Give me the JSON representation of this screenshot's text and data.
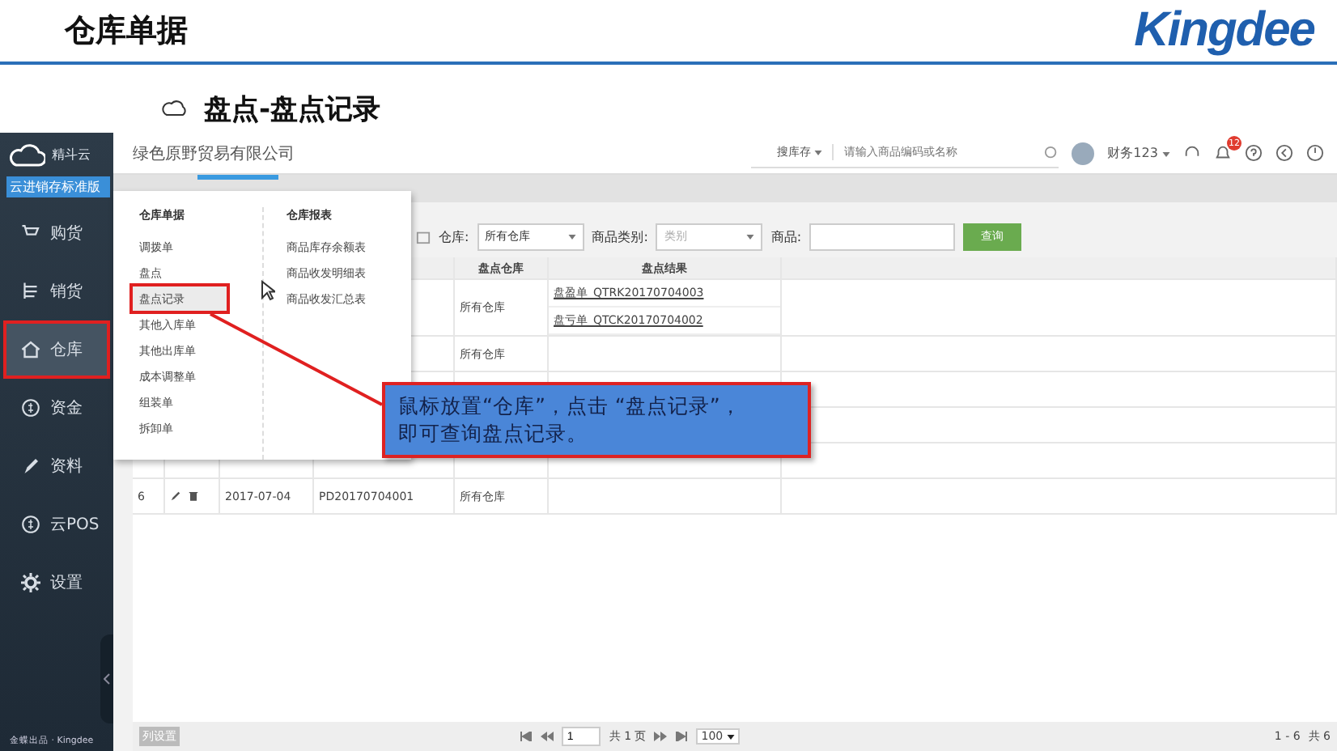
{
  "slide": {
    "title": "仓库单据",
    "logo": "Kingdee",
    "subtitle": "盘点-盘点记录"
  },
  "app": {
    "brand": "精斗云",
    "edition": "云进销存标准版",
    "company": "绿色原野贸易有限公司",
    "search": {
      "scope": "搜库存",
      "placeholder": "请输入商品编码或名称"
    },
    "user": "财务123",
    "notifications": "12",
    "sidebar": [
      {
        "label": "购货",
        "selected": false
      },
      {
        "label": "销货",
        "selected": false
      },
      {
        "label": "仓库",
        "selected": true
      },
      {
        "label": "资金",
        "selected": false
      },
      {
        "label": "资料",
        "selected": false
      },
      {
        "label": "云POS",
        "selected": false
      },
      {
        "label": "设置",
        "selected": false
      }
    ],
    "footer": "金蝶出品 · Kingdee",
    "filters": [
      {
        "label": "仓库:",
        "kind": "select",
        "value": "所有仓库"
      },
      {
        "label": "商品类别:",
        "kind": "select",
        "placeholder": "类别"
      },
      {
        "label": "商品:",
        "kind": "input"
      }
    ],
    "query_button": "查询",
    "table": {
      "columns": [
        "盘点仓库",
        "盘点结果"
      ],
      "rows": [
        {
          "index": "",
          "date": "",
          "number": "",
          "warehouse": "所有仓库",
          "results": [
            "盘盈单_QTRK20170704003",
            "盘亏单_QTCK20170704002"
          ]
        },
        {
          "index": "",
          "date": "",
          "number": "",
          "warehouse": "所有仓库",
          "results": []
        },
        {
          "index": "6",
          "date": "2017-07-04",
          "number": "PD20170704001",
          "warehouse": "所有仓库",
          "results": []
        }
      ]
    },
    "pager": {
      "column_settings": "列设置",
      "page": "1",
      "total_pages": "共 1 页",
      "page_size": "100",
      "range": "1 - 6",
      "total": "共 6"
    },
    "menu": {
      "columns": [
        {
          "heading": "仓库单据",
          "items": [
            {
              "label": "调拨单",
              "selected": false
            },
            {
              "label": "盘点",
              "selected": false
            },
            {
              "label": "盘点记录",
              "selected": true
            },
            {
              "label": "其他入库单",
              "selected": false
            },
            {
              "label": "其他出库单",
              "selected": false
            },
            {
              "label": "成本调整单",
              "selected": false
            },
            {
              "label": "组装单",
              "selected": false
            },
            {
              "label": "拆卸单",
              "selected": false
            }
          ]
        },
        {
          "heading": "仓库报表",
          "items": [
            {
              "label": "商品库存余额表",
              "selected": false
            },
            {
              "label": "商品收发明细表",
              "selected": false
            },
            {
              "label": "商品收发汇总表",
              "selected": false
            }
          ]
        }
      ]
    }
  },
  "callout": {
    "lines": [
      "鼠标放置“仓库”，点击 “盘点记录”，",
      "即可查询盘点记录。"
    ]
  }
}
